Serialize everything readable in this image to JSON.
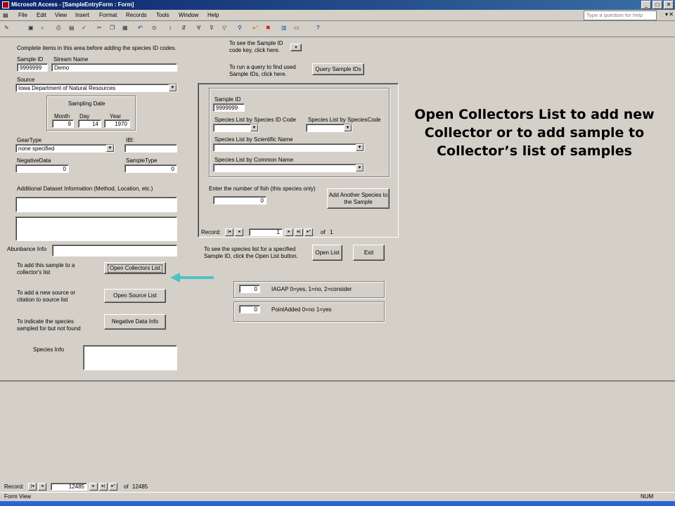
{
  "window": {
    "title": "Microsoft Access - [SampleEntryForm : Form]",
    "help_placeholder": "Type a question for help"
  },
  "menu": [
    "File",
    "Edit",
    "View",
    "Insert",
    "Format",
    "Records",
    "Tools",
    "Window",
    "Help"
  ],
  "form": {
    "intro": "Complete items in this area before adding the species ID codes.",
    "sample_id_label": "Sample ID",
    "sample_id": "9999999",
    "stream_name_label": "Stream Name",
    "stream_name": "Demo",
    "source_label": "Source",
    "source": "Iowa Department of Natural Resources",
    "sampling_date_label": "Sampling Date",
    "month_label": "Month",
    "day_label": "Day",
    "year_label": "Year",
    "month": "9",
    "day": "14",
    "year": "1970",
    "geartype_label": "GearType",
    "geartype": "none specified",
    "ibi_label": "IBI:",
    "ibi": "",
    "negative_label": "NegativeData",
    "negative": "0",
    "sampletype_label": "SampleType",
    "sampletype": "0",
    "additional_label": "Additional Dataset Information (Method, Location, etc.)",
    "abundance_label": "Abunbance Info",
    "collectors_text": "To add this sample to a collector's list",
    "collectors_button": "Open Collectors List",
    "source_text": "To add a new source or citation to source list",
    "source_button": "Open Source List",
    "negative_text": "To indicate the species sampled for but not found",
    "negative_button": "Negative Data Info",
    "species_info_label": "Species Info",
    "key_text": "To see the Sample ID code key, click here.",
    "query_text": "To run a query to find used Sample IDs, click here.",
    "query_button": "Query Sample IDs",
    "sub": {
      "sample_id_label": "Sample ID",
      "sample_id": "9999999",
      "by_id_label": "Species List by Species ID Code",
      "by_code_label": "Species List by SpeciesCode",
      "by_sci_label": "Species List by Scientific Name",
      "by_common_label": "Species List by Common Name",
      "fish_label": "Enter the number of fish (this species only)",
      "fish_value": "0",
      "add_button": "Add Another Species to the Sample",
      "record_label": "Record:",
      "record_value": "1",
      "record_of": "of",
      "record_total": "1"
    },
    "specieslist_text": "To see the species list for a specified Sample ID, click the Open List button.",
    "open_list_button": "Open List",
    "exit_button": "Exit",
    "iagap_value": "0",
    "iagap_label": "IAGAP  0=yes, 1=no, 2=consider",
    "pointadded_value": "0",
    "pointadded_label": "PointAdded 0=no 1=yes"
  },
  "annotation": "Open Collectors List to add new Collector or to add sample to Collector’s list of samples",
  "record_nav": {
    "label": "Record:",
    "value": "12485",
    "of": "of",
    "total": "12485"
  },
  "status": {
    "view": "Form View",
    "num": "NUM"
  },
  "colors": {
    "arrow": "#4fc3c3",
    "face": "#d4d0c8",
    "title": "#0a246a"
  }
}
